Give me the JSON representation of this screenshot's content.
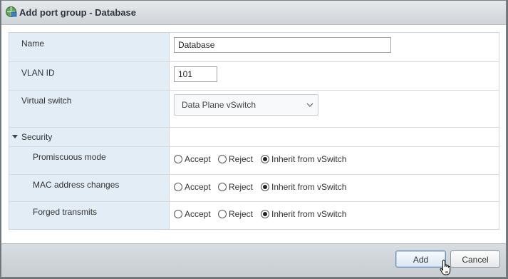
{
  "dialog": {
    "title": "Add port group - Database",
    "icon": "port-group-icon"
  },
  "form": {
    "name": {
      "label": "Name",
      "value": "Database"
    },
    "vlan": {
      "label": "VLAN ID",
      "value": "101"
    },
    "vswitch": {
      "label": "Virtual switch",
      "value": "Data Plane vSwitch"
    },
    "security": {
      "label": "Security",
      "expanded": true,
      "rows": [
        {
          "label": "Promiscuous mode",
          "options": [
            "Accept",
            "Reject",
            "Inherit from vSwitch"
          ],
          "selected": "Inherit from vSwitch"
        },
        {
          "label": "MAC address changes",
          "options": [
            "Accept",
            "Reject",
            "Inherit from vSwitch"
          ],
          "selected": "Inherit from vSwitch"
        },
        {
          "label": "Forged transmits",
          "options": [
            "Accept",
            "Reject",
            "Inherit from vSwitch"
          ],
          "selected": "Inherit from vSwitch"
        }
      ]
    }
  },
  "footer": {
    "add_label": "Add",
    "cancel_label": "Cancel"
  },
  "colors": {
    "label_bg": "#e3edf5",
    "accent": "#6a8fb3"
  }
}
